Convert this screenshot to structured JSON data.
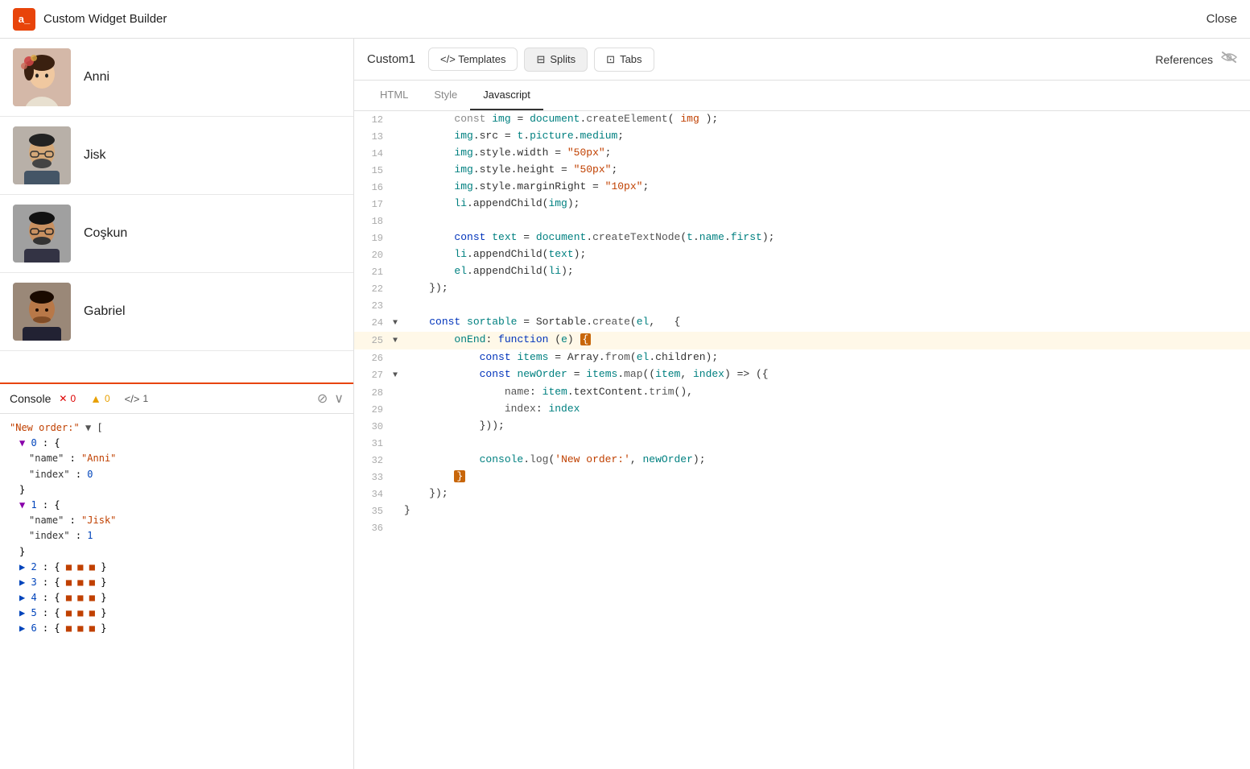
{
  "topbar": {
    "logo": "a_",
    "title": "Custom Widget Builder",
    "close_label": "Close"
  },
  "people": [
    {
      "name": "Anni",
      "avatar_color": "#c8a090"
    },
    {
      "name": "Jisk",
      "avatar_color": "#888888"
    },
    {
      "name": "Coşkun",
      "avatar_color": "#777777"
    },
    {
      "name": "Gabriel",
      "avatar_color": "#9a7060"
    }
  ],
  "console": {
    "title": "Console",
    "error_count": "0",
    "warn_count": "0",
    "info_count": "1",
    "no_icon": "⊘",
    "expand_icon": "∨"
  },
  "editor": {
    "widget_name": "Custom1",
    "templates_label": "</> Templates",
    "splits_label": "⊟ Splits",
    "tabs_label": "⊡ Tabs",
    "references_label": "References",
    "tabs": [
      "HTML",
      "Style",
      "Javascript"
    ],
    "active_tab": "Javascript"
  },
  "code_lines": [
    {
      "num": "12",
      "arrow": "",
      "highlighted": false,
      "content": "        const img = document.createElement( img );"
    },
    {
      "num": "13",
      "arrow": "",
      "highlighted": false,
      "content": "        img.src = t.picture.medium;"
    },
    {
      "num": "14",
      "arrow": "",
      "highlighted": false,
      "content": "        img.style.width = \"50px\";"
    },
    {
      "num": "15",
      "arrow": "",
      "highlighted": false,
      "content": "        img.style.height = \"50px\";"
    },
    {
      "num": "16",
      "arrow": "",
      "highlighted": false,
      "content": "        img.style.marginRight = \"10px\";"
    },
    {
      "num": "17",
      "arrow": "",
      "highlighted": false,
      "content": "        li.appendChild(img);"
    },
    {
      "num": "18",
      "arrow": "",
      "highlighted": false,
      "content": ""
    },
    {
      "num": "19",
      "arrow": "",
      "highlighted": false,
      "content": "        const text = document.createTextNode(t.name.first);"
    },
    {
      "num": "20",
      "arrow": "",
      "highlighted": false,
      "content": "        li.appendChild(text);"
    },
    {
      "num": "21",
      "arrow": "",
      "highlighted": false,
      "content": "        el.appendChild(li);"
    },
    {
      "num": "22",
      "arrow": "",
      "highlighted": false,
      "content": "    });"
    },
    {
      "num": "23",
      "arrow": "",
      "highlighted": false,
      "content": ""
    },
    {
      "num": "24",
      "arrow": "▼",
      "highlighted": false,
      "content": "    const sortable = Sortable.create(el,   {"
    },
    {
      "num": "25",
      "arrow": "▼",
      "highlighted": true,
      "content": "        onEnd: function (e) {"
    },
    {
      "num": "26",
      "arrow": "",
      "highlighted": false,
      "content": "            const items = Array.from(el.children);"
    },
    {
      "num": "27",
      "arrow": "▼",
      "highlighted": false,
      "content": "            const newOrder = items.map((item, index) => ({"
    },
    {
      "num": "28",
      "arrow": "",
      "highlighted": false,
      "content": "                name: item.textContent.trim(),"
    },
    {
      "num": "29",
      "arrow": "",
      "highlighted": false,
      "content": "                index: index"
    },
    {
      "num": "30",
      "arrow": "",
      "highlighted": false,
      "content": "            }));"
    },
    {
      "num": "31",
      "arrow": "",
      "highlighted": false,
      "content": ""
    },
    {
      "num": "32",
      "arrow": "",
      "highlighted": false,
      "content": "            console.log('New order:', newOrder);"
    },
    {
      "num": "33",
      "arrow": "",
      "highlighted": false,
      "content": "        }"
    },
    {
      "num": "34",
      "arrow": "",
      "highlighted": false,
      "content": "    });"
    },
    {
      "num": "35",
      "arrow": "",
      "highlighted": false,
      "content": "}"
    },
    {
      "num": "36",
      "arrow": "",
      "highlighted": false,
      "content": ""
    }
  ]
}
